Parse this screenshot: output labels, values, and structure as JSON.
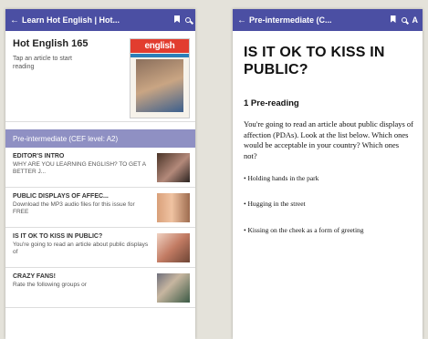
{
  "left": {
    "appbar": {
      "back": "←",
      "title": "Learn Hot English | Hot..."
    },
    "issue": {
      "title": "Hot English 165",
      "subtitle": "Tap an article to start reading",
      "cover_label": "english"
    },
    "section": "Pre-intermediate (CEF level: A2)",
    "articles": [
      {
        "title": "EDITOR'S INTRO",
        "desc": "WHY ARE YOU LEARNING ENGLISH? TO GET A BETTER J..."
      },
      {
        "title": "PUBLIC DISPLAYS OF AFFEC...",
        "desc": "Download the MP3 audio files for this issue for FREE"
      },
      {
        "title": "IS IT OK TO KISS IN PUBLIC?",
        "desc": "You're going to read an article about public displays of"
      },
      {
        "title": "CRAZY FANS!",
        "desc": "Rate the following groups or"
      }
    ]
  },
  "right": {
    "appbar": {
      "back": "←",
      "title": "Pre-intermediate (C...",
      "font_icon": "A"
    },
    "heading": "IS IT OK TO KISS IN PUBLIC?",
    "section_title": "1 Pre-reading",
    "body": "You're going to read an article about public displays of affection (PDAs). Look at the list below. Which ones would be acceptable in your country? Which ones not?",
    "bullets": [
      "• Holding hands in the park",
      "• Hugging in the street",
      "• Kissing on the cheek as a form of greeting"
    ]
  },
  "colors": {
    "appbar": "#4b4fa3",
    "section_bar": "#8f90c3",
    "background": "#e4e2da"
  },
  "icons": [
    "back-arrow-icon",
    "bookmark-icon",
    "search-icon",
    "font-size-icon"
  ]
}
